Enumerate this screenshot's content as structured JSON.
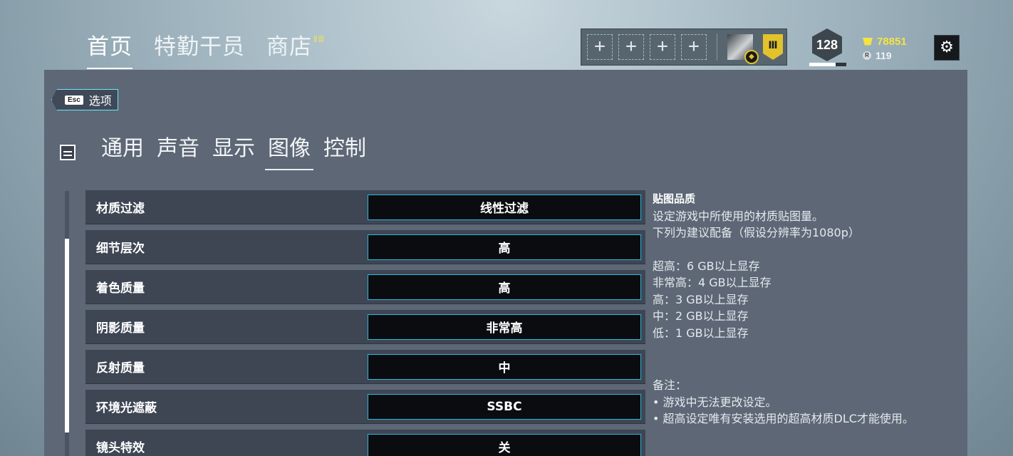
{
  "top_nav": {
    "items": [
      {
        "label": "首页",
        "active": true
      },
      {
        "label": "特勤干员",
        "active": false
      },
      {
        "label": "商店",
        "active": false
      }
    ]
  },
  "squad": {
    "empty_slot_symbol": "+"
  },
  "player": {
    "level": "128",
    "level_progress": 0.72,
    "renown": "78851",
    "credits": "119"
  },
  "back_button": {
    "key": "Esc",
    "label": "选项"
  },
  "sub_tabs": [
    {
      "label": "通用",
      "active": false
    },
    {
      "label": "声音",
      "active": false
    },
    {
      "label": "显示",
      "active": false
    },
    {
      "label": "图像",
      "active": true
    },
    {
      "label": "控制",
      "active": false
    }
  ],
  "settings": [
    {
      "label": "材质过滤",
      "value": "线性过滤",
      "selected": true
    },
    {
      "label": "细节层次",
      "value": "高",
      "selected": false
    },
    {
      "label": "着色质量",
      "value": "高",
      "selected": false
    },
    {
      "label": "阴影质量",
      "value": "非常高",
      "selected": false
    },
    {
      "label": "反射质量",
      "value": "中",
      "selected": false
    },
    {
      "label": "环境光遮蔽",
      "value": "SSBC",
      "selected": false
    },
    {
      "label": "镜头特效",
      "value": "关",
      "selected": false
    }
  ],
  "description": {
    "title": "贴图品质",
    "line1": "设定游戏中所使用的材质贴图量。",
    "line2": "下列为建议配备（假设分辨率为1080p）",
    "req1": "超高：6 GB以上显存",
    "req2": "非常高：4 GB以上显存",
    "req3": "高：3 GB以上显存",
    "req4": "中：2 GB以上显存",
    "req5": "低：1 GB以上显存",
    "notes_title": "备注：",
    "note1": "• 游戏中无法更改设定。",
    "note2": "• 超高设定唯有安装选用的超高材质DLC才能使用。"
  },
  "colors": {
    "accent": "#2fb7e0",
    "renown": "#f3e343",
    "panel": "#5d6776",
    "row": "#3e4654"
  }
}
